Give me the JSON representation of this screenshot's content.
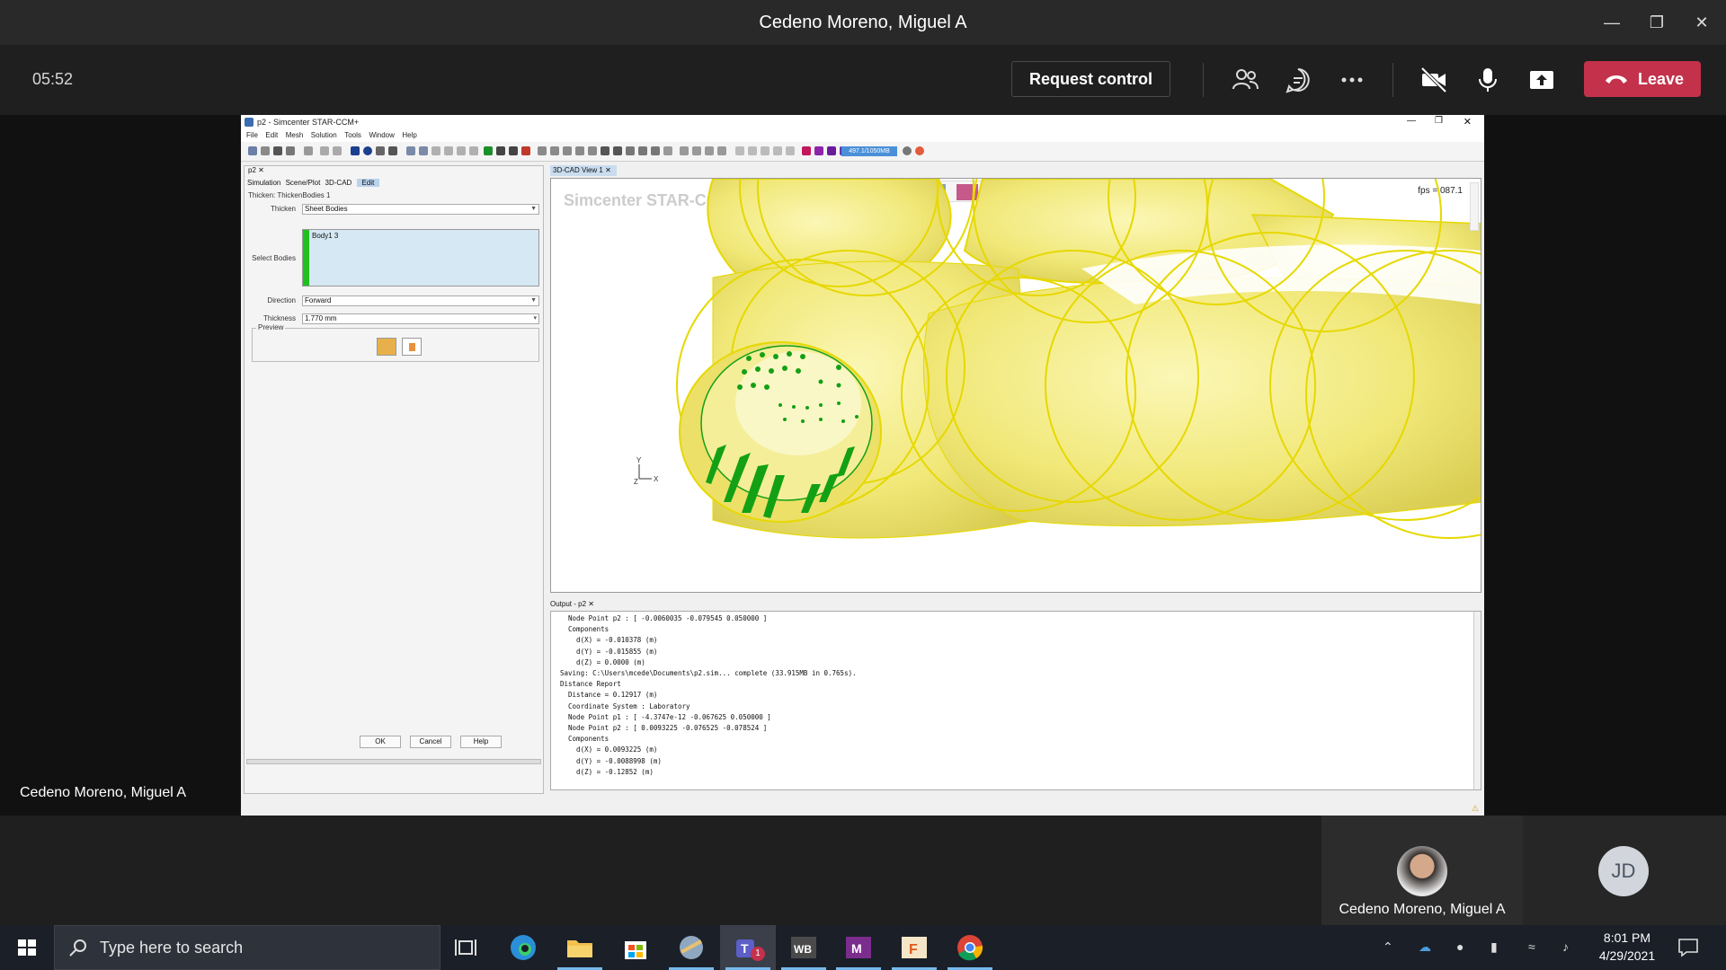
{
  "teams": {
    "window_title": "Cedeno Moreno, Miguel A",
    "timer": "05:52",
    "request_control": "Request control",
    "leave": "Leave",
    "presenter_name": "Cedeno Moreno, Miguel A"
  },
  "participants": [
    {
      "name": "Cedeno Moreno, Miguel A"
    },
    {
      "initials": "JD"
    }
  ],
  "star": {
    "title": "p2 - Simcenter STAR-CCM+",
    "menu": [
      "File",
      "Edit",
      "Mesh",
      "Solution",
      "Tools",
      "Window",
      "Help"
    ],
    "memory": "497.1/1050MB",
    "left_tab": "p2",
    "subtabs": [
      "Simulation",
      "Scene/Plot",
      "3D-CAD",
      "Edit"
    ],
    "thicken_title": "Thicken: ThickenBodies 1",
    "form": {
      "thicken_label": "Thicken",
      "thicken_value": "Sheet Bodies",
      "select_label": "Select Bodies",
      "select_value": "Body1 3",
      "direction_label": "Direction",
      "direction_value": "Forward",
      "thickness_label": "Thickness",
      "thickness_value": "1.770 mm",
      "preview_label": "Preview"
    },
    "buttons": {
      "ok": "OK",
      "cancel": "Cancel",
      "help": "Help"
    },
    "view_tab": "3D-CAD View 1",
    "watermark": "Simcenter STAR-CCM",
    "fps": "fps = 087.1",
    "output_tab": "Output - p2",
    "output_lines": [
      "  Node Point p2 : [ -0.0060035 -0.079545 0.050000 ]",
      "  Components",
      "    d(X) = -0.010378 (m)",
      "    d(Y) = -0.015855 (m)",
      "    d(Z) = 0.0000 (m)",
      "Saving: C:\\Users\\mcede\\Documents\\p2.sim... complete (33.915MB in 0.765s).",
      "Distance Report",
      "  Distance = 0.12917 (m)",
      "  Coordinate System : Laboratory",
      "  Node Point p1 : [ -4.3747e-12 -0.067625 0.050000 ]",
      "  Node Point p2 : [ 0.0093225 -0.076525 -0.078524 ]",
      "  Components",
      "    d(X) = 0.0093225 (m)",
      "    d(Y) = -0.0088998 (m)",
      "    d(Z) = -0.12852 (m)"
    ]
  },
  "taskbar": {
    "search_placeholder": "Type here to search",
    "time": "8:01 PM",
    "date": "4/29/2021",
    "teams_badge": "1"
  },
  "colors": {
    "leave_red": "#c4314b",
    "cad_yellow": "#f3ec86",
    "cad_edge": "#e6d800",
    "mesh_green": "#14a014"
  }
}
